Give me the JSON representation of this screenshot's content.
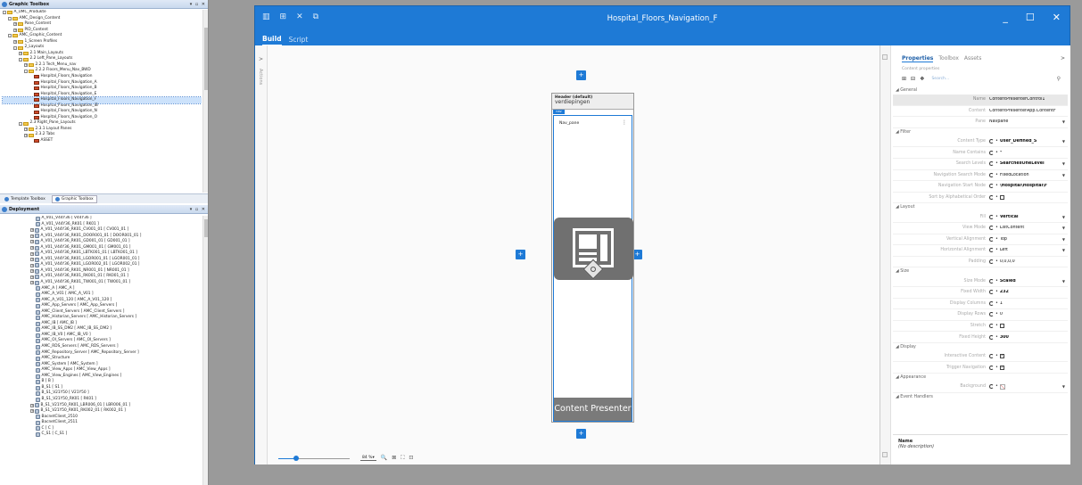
{
  "graphic_toolbox": {
    "title": "Graphic Toolbox",
    "controls": "▾ ▫ ✕",
    "tree": [
      {
        "label": "A_UMC_Produkte",
        "indent": 0,
        "exp": "-",
        "icon": "fold"
      },
      {
        "label": "AMC_Design_Content",
        "indent": 1,
        "exp": "-",
        "icon": "fold"
      },
      {
        "label": "Pane_Content",
        "indent": 2,
        "exp": "+",
        "icon": "fold"
      },
      {
        "label": "PID_Content",
        "indent": 2,
        "exp": "+",
        "icon": "fold"
      },
      {
        "label": "AMC_Graphic_Content",
        "indent": 1,
        "exp": "-",
        "icon": "fold"
      },
      {
        "label": "1_Screen Profiles",
        "indent": 2,
        "exp": "+",
        "icon": "fold"
      },
      {
        "label": "2_Layouts",
        "indent": 2,
        "exp": "-",
        "icon": "fold"
      },
      {
        "label": "2.1 Main_Layouts",
        "indent": 3,
        "exp": "+",
        "icon": "fold"
      },
      {
        "label": "2.2 Left_Pane_Layouts",
        "indent": 3,
        "exp": "-",
        "icon": "fold"
      },
      {
        "label": "2.2.1 Tech_Menu_nav",
        "indent": 4,
        "exp": "+",
        "icon": "fold"
      },
      {
        "label": "2.2.2 Floors_Menu_Nav_BWD",
        "indent": 4,
        "exp": "-",
        "icon": "fold"
      },
      {
        "label": "Hospital_Floors_Navigation",
        "indent": 5,
        "exp": "",
        "icon": "scr"
      },
      {
        "label": "Hospital_Floors_Navigation_A",
        "indent": 5,
        "exp": "",
        "icon": "scr"
      },
      {
        "label": "Hospital_Floors_Navigation_B",
        "indent": 5,
        "exp": "",
        "icon": "scr"
      },
      {
        "label": "Hospital_Floors_Navigation_E",
        "indent": 5,
        "exp": "",
        "icon": "scr"
      },
      {
        "label": "Hospital_Floors_Navigation_F",
        "indent": 5,
        "exp": "",
        "icon": "scr",
        "selected": true
      },
      {
        "label": "Hospital_Floors_Navigation_IB",
        "indent": 5,
        "exp": "",
        "icon": "scr"
      },
      {
        "label": "Hospital_Floors_Navigation_N",
        "indent": 5,
        "exp": "",
        "icon": "scr"
      },
      {
        "label": "Hospital_Floors_Navigation_O",
        "indent": 5,
        "exp": "",
        "icon": "scr"
      },
      {
        "label": "2.3 Right_Pane_Layouts",
        "indent": 3,
        "exp": "-",
        "icon": "fold"
      },
      {
        "label": "2.3.1 Layout Panes",
        "indent": 4,
        "exp": "+",
        "icon": "fold"
      },
      {
        "label": "2.3.2 Tabs",
        "indent": 4,
        "exp": "+",
        "icon": "fold"
      },
      {
        "label": "ASSET",
        "indent": 5,
        "exp": "",
        "icon": "scr"
      }
    ]
  },
  "tabs": [
    {
      "label": "Template Toolbox",
      "active": false
    },
    {
      "label": "Graphic Toolbox",
      "active": true
    }
  ],
  "deployment": {
    "title": "Deployment",
    "controls": "▾ ▫ ✕",
    "tree": [
      {
        "label": "A_V01_V44Y36 [ V44Y36 ]",
        "exp": ""
      },
      {
        "label": "A_V01_V44Y36_RK01 [ RK01 ]",
        "exp": ""
      },
      {
        "label": "A_V01_V44Y36_RK01_CV001_01 [ CV001_01 ]",
        "exp": "+"
      },
      {
        "label": "A_V01_V44Y36_RK01_DOOR001_01 [ DOOR001_01 ]",
        "exp": "+"
      },
      {
        "label": "A_V01_V44Y36_RK01_GD001_01 [ GD001_01 ]",
        "exp": "+"
      },
      {
        "label": "A_V01_V44Y36_RK01_GM001_01 [ GM001_01 ]",
        "exp": "+"
      },
      {
        "label": "A_V01_V44Y36_RK01_LBTK001_01 [ LBTK001_01 ]",
        "exp": "+"
      },
      {
        "label": "A_V01_V44Y36_RK01_LGOR001_01 [ LGOR001_01 ]",
        "exp": "+"
      },
      {
        "label": "A_V01_V44Y36_RK01_LGOR002_01 [ LGOR002_01 ]",
        "exp": "+"
      },
      {
        "label": "A_V01_V44Y36_RK01_NR001_01 [ NR001_01 ]",
        "exp": "+"
      },
      {
        "label": "A_V01_V44Y36_RK01_RK001_01 [ RK001_01 ]",
        "exp": "+"
      },
      {
        "label": "A_V01_V44Y36_RK01_TW001_01 [ TW001_01 ]",
        "exp": "+"
      },
      {
        "label": "AMC_A [ AMC_A ]",
        "exp": ""
      },
      {
        "label": "AMC_A_V01 [ AMC_A_V01 ]",
        "exp": ""
      },
      {
        "label": "AMC_A_V01_120 [ AMC_A_V01_120 ]",
        "exp": ""
      },
      {
        "label": "AMC_App_Servers [ AMC_App_Servers ]",
        "exp": ""
      },
      {
        "label": "AMC_Client_Servers [ AMC_Client_Servers ]",
        "exp": ""
      },
      {
        "label": "AMC_Historian_Servers [ AMC_Historian_Servers ]",
        "exp": ""
      },
      {
        "label": "AMC_IB [ AMC_IB ]",
        "exp": ""
      },
      {
        "label": "AMC_IB_SS_DM2 [ AMC_IB_SS_DM2 ]",
        "exp": ""
      },
      {
        "label": "AMC_IB_V0 [ AMC_IB_V0 ]",
        "exp": ""
      },
      {
        "label": "AMC_OI_Servers [ AMC_OI_Servers ]",
        "exp": ""
      },
      {
        "label": "AMC_RDS_Servers [ AMC_RDS_Servers ]",
        "exp": ""
      },
      {
        "label": "AMC_Repository_Server [ AMC_Repository_Server ]",
        "exp": ""
      },
      {
        "label": "AMC_Structure",
        "exp": ""
      },
      {
        "label": "AMC_System [ AMC_System ]",
        "exp": ""
      },
      {
        "label": "AMC_View_Apps [ AMC_View_Apps ]",
        "exp": ""
      },
      {
        "label": "AMC_View_Engines [ AMC_View_Engines ]",
        "exp": ""
      },
      {
        "label": "B [ B ]",
        "exp": ""
      },
      {
        "label": "B_S1 [ S1 ]",
        "exp": ""
      },
      {
        "label": "B_S1_V21Y50 [ V21Y50 ]",
        "exp": ""
      },
      {
        "label": "B_S1_V21Y50_RK01 [ RK01 ]",
        "exp": ""
      },
      {
        "label": "B_S1_V21Y50_RK01_LBR006_01 [ LBR006_01 ]",
        "exp": "+"
      },
      {
        "label": "B_S1_V21Y50_RK01_RK002_01 [ RK002_01 ]",
        "exp": "+"
      },
      {
        "label": "BacnetClient_2510",
        "exp": ""
      },
      {
        "label": "BacnetClient_2511",
        "exp": ""
      },
      {
        "label": "C [ C ]",
        "exp": ""
      },
      {
        "label": "C_S1 [ C_S1 ]",
        "exp": ""
      }
    ]
  },
  "window": {
    "title": "Hospital_Floors_Navigation_F",
    "tb_icons": [
      "▥",
      "⊞",
      "✕",
      "⧉"
    ],
    "ctl_min": "_",
    "ctl_max": "☐",
    "ctl_close": "✕",
    "modes": [
      {
        "label": "Build",
        "active": true
      },
      {
        "label": "Script",
        "active": false
      }
    ]
  },
  "leftstrip": {
    "arrow": ">",
    "label": "Actions"
  },
  "canvas": {
    "add": "+",
    "header_default": "Header (default)",
    "header_text": "verdiepingen",
    "nav_label": "nav",
    "nav_pane": "Nav_pane",
    "kebab": "⋮",
    "content_presenter": "Content Presenter"
  },
  "zoom": {
    "value": "84 %",
    "arrow": "▾",
    "level": 0.25,
    "icons": [
      "🔍",
      "⊠",
      "⛶",
      "⊡"
    ]
  },
  "properties": {
    "tabs": [
      {
        "label": "Properties",
        "active": true
      },
      {
        "label": "Toolbox",
        "active": false
      },
      {
        "label": "Assets",
        "active": false
      }
    ],
    "chevron": ">",
    "subtitle": "Content properties",
    "tools": [
      "⊞",
      "⊟",
      "❖"
    ],
    "search_placeholder": "Search...",
    "search_icon": "⚲",
    "sections": [
      {
        "title": "◢ General",
        "rows": [
          {
            "name": "Name",
            "value": "ContentPresenterControl1",
            "kind": "plain"
          },
          {
            "name": "Content",
            "value": "ContentPresenterApp.ContentF",
            "kind": "plain"
          },
          {
            "name": "Pane",
            "value": "Navpane",
            "kind": "plain",
            "dropdown": true
          }
        ]
      },
      {
        "title": "◢ Filter",
        "rows": [
          {
            "name": "Content Type",
            "value": "User_Defined_S",
            "kind": "bold",
            "dropdown": true
          },
          {
            "name": "Name Contains",
            "value": "*",
            "kind": "text"
          },
          {
            "name": "Search Levels",
            "value": "SearchesOneLevel",
            "kind": "bold",
            "dropdown": true
          },
          {
            "name": "Navigation Search Mode",
            "value": "FixedLocation",
            "kind": "text",
            "dropdown": true
          },
          {
            "name": "Navigation Start Node",
            "value": "\\Hospital\\Hospital\\F",
            "kind": "bold"
          },
          {
            "name": "Sort by Alphabetical Order",
            "value": "",
            "kind": "check",
            "checked": false
          }
        ]
      },
      {
        "title": "◢ Layout",
        "rows": [
          {
            "name": "Fill",
            "value": "Vertical",
            "kind": "bold",
            "dropdown": true
          },
          {
            "name": "View Mode",
            "value": "ListContent",
            "kind": "text",
            "dropdown": true
          },
          {
            "name": "Vertical Alignment",
            "value": "Top",
            "kind": "text",
            "dropdown": true
          },
          {
            "name": "Horizontal Alignment",
            "value": "Left",
            "kind": "text",
            "dropdown": true
          },
          {
            "name": "Padding",
            "value": "0,0,0,0",
            "kind": "text"
          }
        ]
      },
      {
        "title": "◢ Size",
        "rows": [
          {
            "name": "Size Mode",
            "value": "Scaled",
            "kind": "bold",
            "dropdown": true
          },
          {
            "name": "Fixed Width",
            "value": "232",
            "kind": "bold"
          },
          {
            "name": "Display Columns",
            "value": "1",
            "kind": "text"
          },
          {
            "name": "Display Rows",
            "value": "0",
            "kind": "text"
          },
          {
            "name": "Stretch",
            "value": "",
            "kind": "check",
            "checked": false
          },
          {
            "name": "Fixed Height",
            "value": "300",
            "kind": "bold"
          }
        ]
      },
      {
        "title": "◢ Display",
        "rows": [
          {
            "name": "Interactive Content",
            "value": "",
            "kind": "check",
            "checked": true
          },
          {
            "name": "Trigger Navigation",
            "value": "",
            "kind": "check",
            "checked": true
          }
        ]
      },
      {
        "title": "◢ Appearance",
        "rows": [
          {
            "name": "Background",
            "value": "",
            "kind": "bg",
            "dropdown": true
          }
        ]
      },
      {
        "title": "◢ Event Handlers",
        "rows": []
      }
    ],
    "desc_title": "Name",
    "desc_text": "(No description)"
  }
}
